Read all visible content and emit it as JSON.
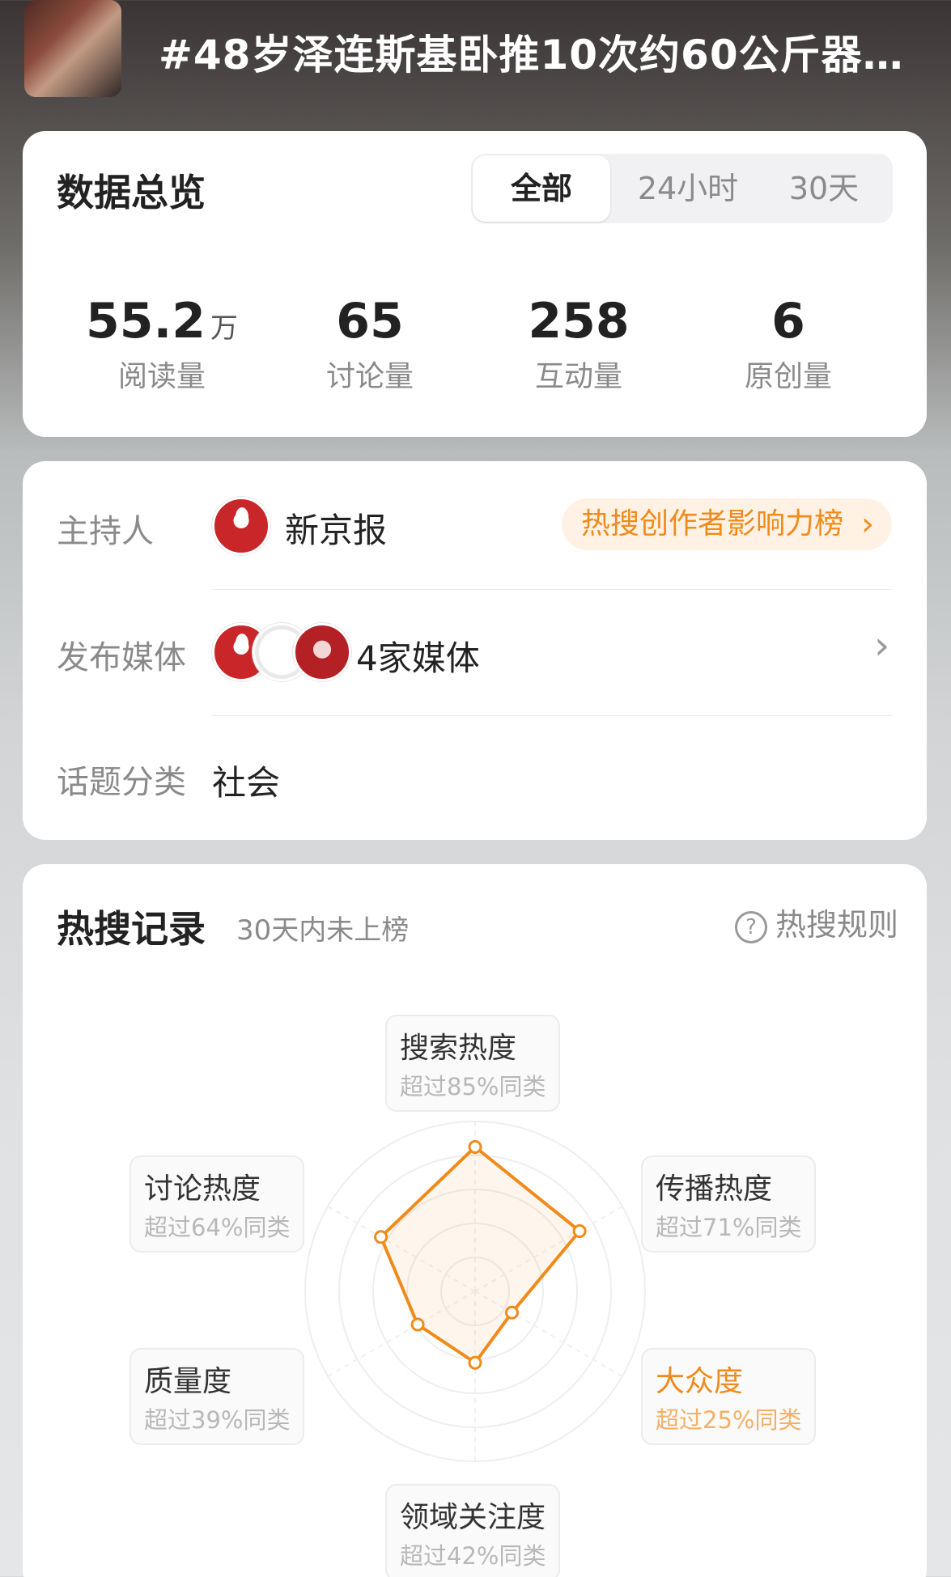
{
  "topic": {
    "title": "#48岁泽连斯基卧推10次约60公斤器…"
  },
  "overview": {
    "heading": "数据总览",
    "tabs": [
      "全部",
      "24小时",
      "30天"
    ],
    "active_tab": "全部",
    "stats": [
      {
        "value": "55.2",
        "unit": "万",
        "label": "阅读量"
      },
      {
        "value": "65",
        "unit": "",
        "label": "讨论量"
      },
      {
        "value": "258",
        "unit": "",
        "label": "互动量"
      },
      {
        "value": "6",
        "unit": "",
        "label": "原创量"
      }
    ]
  },
  "info": {
    "host_label": "主持人",
    "host_name": "新京报",
    "rank_link": "热搜创作者影响力榜",
    "media_label": "发布媒体",
    "media_count": "4家媒体",
    "category_label": "话题分类",
    "category_value": "社会"
  },
  "hot_search": {
    "heading": "热搜记录",
    "subtitle": "30天内未上榜",
    "rules_link": "热搜规则",
    "accent_color": "#f08a1a",
    "dimensions": [
      {
        "name": "搜索热度",
        "value": "超过85%同类",
        "percent": 85
      },
      {
        "name": "传播热度",
        "value": "超过71%同类",
        "percent": 71
      },
      {
        "name": "大众度",
        "value": "超过25%同类",
        "percent": 25
      },
      {
        "name": "领域关注度",
        "value": "超过42%同类",
        "percent": 42
      },
      {
        "name": "质量度",
        "value": "超过39%同类",
        "percent": 39
      },
      {
        "name": "讨论热度",
        "value": "超过64%同类",
        "percent": 64
      }
    ]
  }
}
